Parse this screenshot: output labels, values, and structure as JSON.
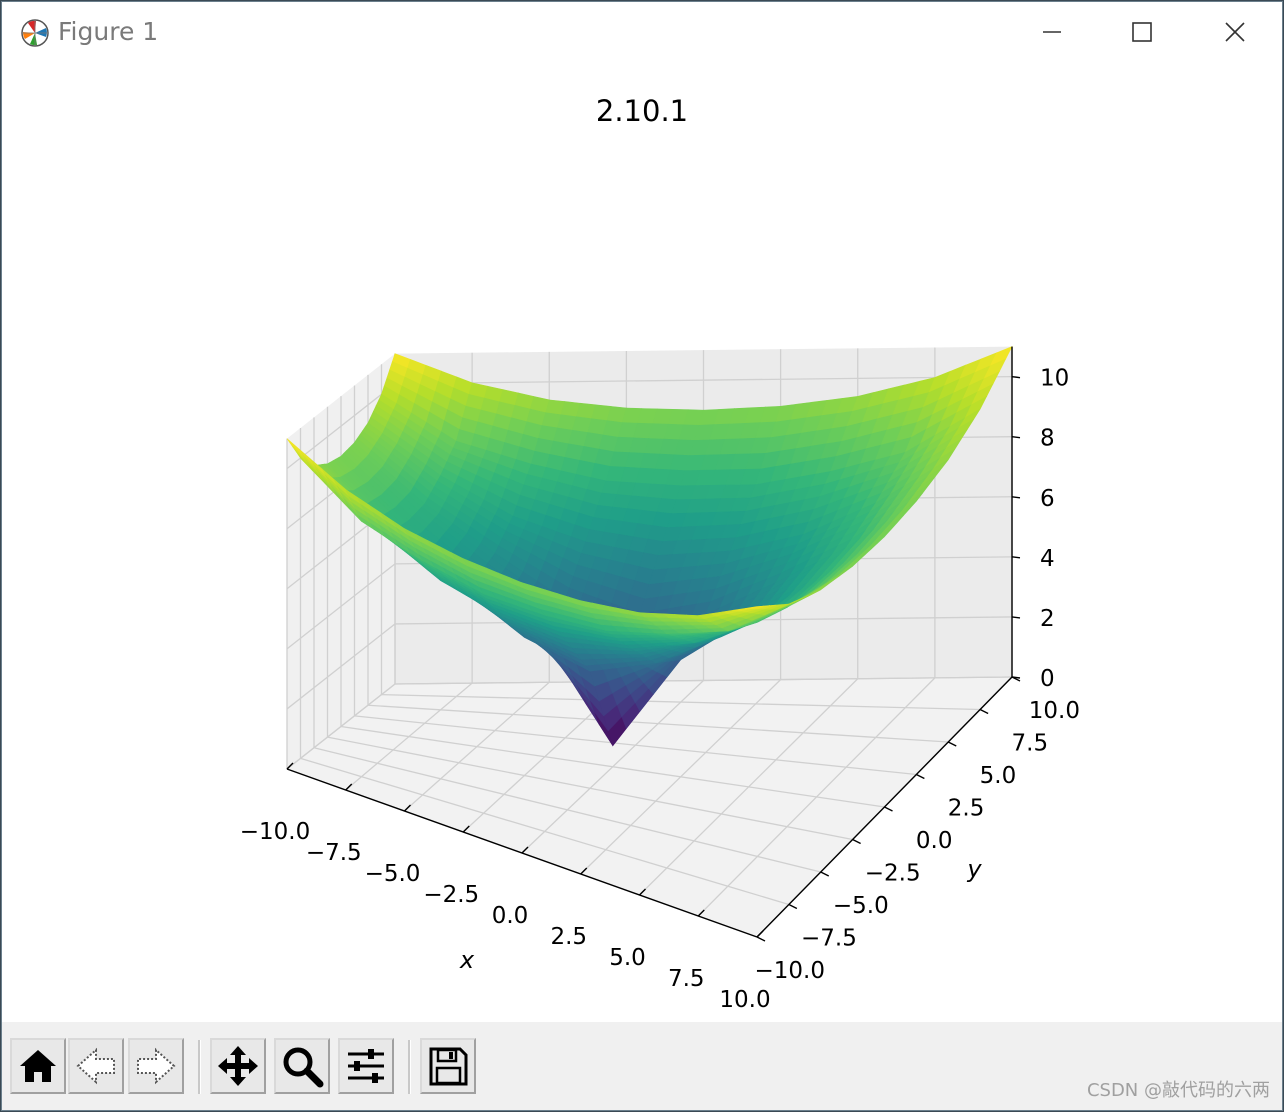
{
  "window": {
    "title": "Figure 1",
    "controls": [
      "minimize",
      "maximize",
      "close"
    ]
  },
  "toolbar": {
    "buttons": [
      {
        "name": "home",
        "icon": "home-icon"
      },
      {
        "name": "back",
        "icon": "back-arrow-icon"
      },
      {
        "name": "forward",
        "icon": "forward-arrow-icon"
      },
      {
        "name": "pan",
        "icon": "move-icon"
      },
      {
        "name": "zoom",
        "icon": "zoom-icon"
      },
      {
        "name": "configure-subplots",
        "icon": "sliders-icon"
      },
      {
        "name": "save",
        "icon": "save-icon"
      }
    ]
  },
  "watermark": "CSDN @敲代码的六两",
  "chart_data": {
    "type": "surface",
    "title": "2.10.1",
    "xlabel": "x",
    "ylabel": "y",
    "zlabel": "",
    "xlim": [
      -10,
      10
    ],
    "ylim": [
      -10,
      10
    ],
    "zlim": [
      0,
      11
    ],
    "x_ticks": [
      "−10.0",
      "−7.5",
      "−5.0",
      "−2.5",
      "0.0",
      "2.5",
      "5.0",
      "7.5",
      "10.0"
    ],
    "y_ticks": [
      "−10.0",
      "−7.5",
      "−5.0",
      "−2.5",
      "0.0",
      "2.5",
      "5.0",
      "7.5",
      "10.0"
    ],
    "z_ticks": [
      "0",
      "2",
      "4",
      "6",
      "8",
      "10"
    ],
    "x_tick_values": [
      -10,
      -7.5,
      -5,
      -2.5,
      0,
      2.5,
      5,
      7.5,
      10
    ],
    "y_tick_values": [
      -10,
      -7.5,
      -5,
      -2.5,
      0,
      2.5,
      5,
      7.5,
      10
    ],
    "z_tick_values": [
      0,
      2,
      4,
      6,
      8,
      10
    ],
    "grid": true,
    "colormap": "viridis",
    "colormap_stops": [
      "#440154",
      "#482878",
      "#3e4989",
      "#31688e",
      "#26828e",
      "#1f9e89",
      "#35b779",
      "#6ece58",
      "#b5de2b",
      "#fde725"
    ],
    "surface_samples": {
      "x": [
        -10,
        -7.5,
        -5,
        -2.5,
        0,
        2.5,
        5,
        7.5,
        10
      ],
      "y": [
        -10,
        -7.5,
        -5,
        -2.5,
        0,
        2.5,
        5,
        7.5,
        10
      ],
      "z": [
        [
          11.0,
          10.0,
          9.4,
          9.1,
          9.0,
          9.1,
          9.4,
          10.0,
          11.0
        ],
        [
          10.0,
          8.5,
          7.8,
          7.3,
          7.2,
          7.3,
          7.8,
          8.5,
          10.0
        ],
        [
          9.4,
          7.8,
          6.6,
          5.9,
          5.6,
          5.9,
          6.6,
          7.8,
          9.4
        ],
        [
          9.1,
          7.3,
          5.9,
          4.6,
          3.9,
          4.6,
          5.9,
          7.3,
          9.1
        ],
        [
          9.0,
          7.2,
          5.6,
          3.9,
          0.7,
          3.9,
          5.6,
          7.2,
          9.0
        ],
        [
          9.1,
          7.3,
          5.9,
          4.6,
          3.9,
          4.6,
          5.9,
          7.3,
          9.1
        ],
        [
          9.4,
          7.8,
          6.6,
          5.9,
          5.6,
          5.9,
          6.6,
          7.8,
          9.4
        ],
        [
          10.0,
          8.5,
          7.8,
          7.3,
          7.2,
          7.3,
          7.8,
          8.5,
          10.0
        ],
        [
          11.0,
          10.0,
          9.4,
          9.1,
          9.0,
          9.1,
          9.4,
          10.0,
          11.0
        ]
      ]
    }
  }
}
